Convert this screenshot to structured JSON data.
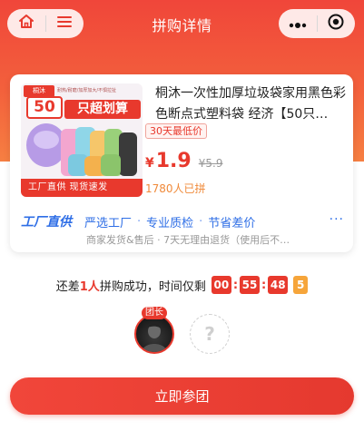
{
  "header": {
    "title": "拼购详情",
    "left_icons": [
      "home-icon",
      "menu-icon"
    ],
    "right_icons": [
      "more-icon",
      "target-icon"
    ]
  },
  "product": {
    "image": {
      "brand": "桐沐",
      "caption": "耐热/耐磨/加厚加大/不惧拉扯",
      "count": "50",
      "slogan": "只超划算",
      "strip": "工厂直供   现货速发"
    },
    "title": "桐沐一次性加厚垃圾袋家用黑色彩色断点式塑料袋 经济【50只…",
    "lowest_badge": "30天最低价",
    "currency": "¥",
    "price": "1.9",
    "original_price": "¥5.9",
    "sold": "1780人已拼"
  },
  "features": {
    "logo": "工厂直供",
    "items": [
      "严选工厂",
      "专业质检",
      "节省差价"
    ],
    "more": "···"
  },
  "service": "商家发货&售后 · 7天无理由退货（使用后不…",
  "countdown": {
    "prefix": "还差",
    "need": "1人",
    "suffix": "拼购成功，时间仅剩",
    "hours": "00",
    "minutes": "55",
    "seconds": "48",
    "ms": "5"
  },
  "group": {
    "leader_label": "团长",
    "empty_slot": "?"
  },
  "join_button": "立即参团"
}
